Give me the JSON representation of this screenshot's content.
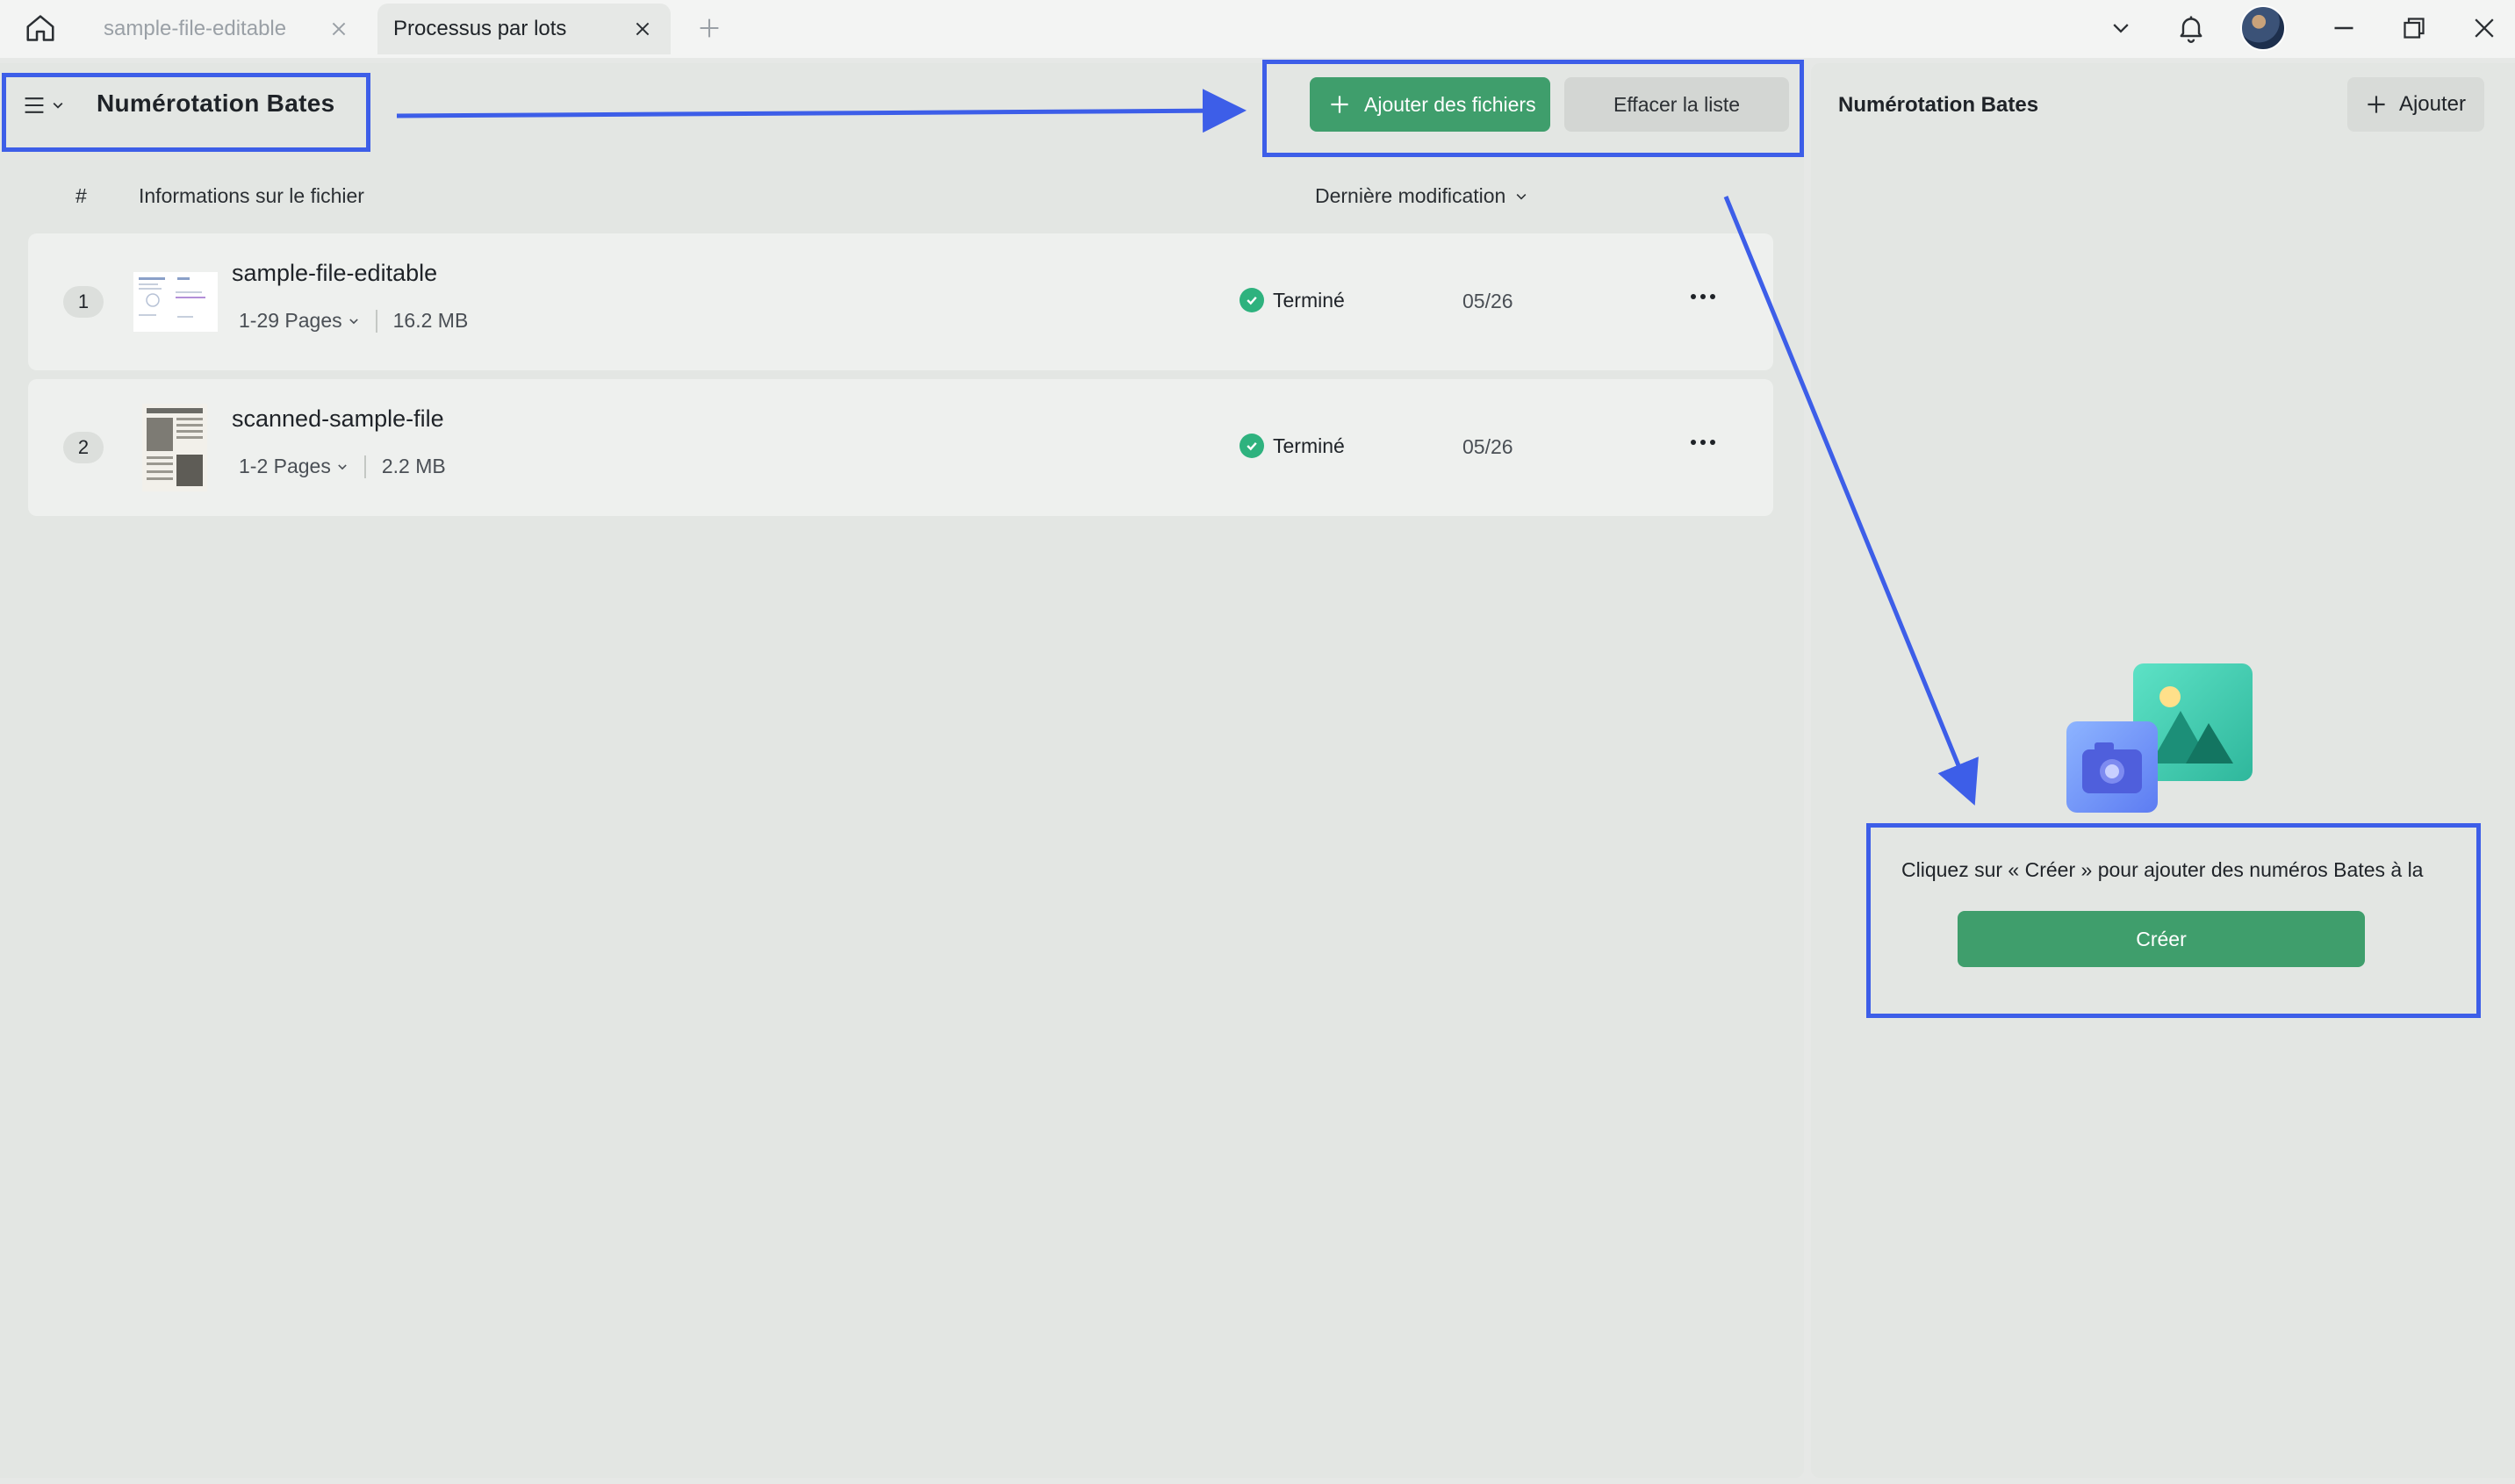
{
  "tabs": [
    {
      "label": "sample-file-editable",
      "active": false
    },
    {
      "label": "Processus par lots",
      "active": true
    }
  ],
  "header": {
    "title": "Numérotation Bates",
    "add_files_label": "Ajouter des fichiers",
    "clear_list_label": "Effacer la liste"
  },
  "columns": {
    "index": "#",
    "info": "Informations sur le fichier",
    "date": "Dernière modification"
  },
  "files": [
    {
      "index": "1",
      "name": "sample-file-editable",
      "pages": "1-29 Pages",
      "size": "16.2 MB",
      "status": "Terminé",
      "date": "05/26"
    },
    {
      "index": "2",
      "name": "scanned-sample-file",
      "pages": "1-2 Pages",
      "size": "2.2 MB",
      "status": "Terminé",
      "date": "05/26"
    }
  ],
  "side_panel": {
    "title": "Numérotation Bates",
    "add_label": "Ajouter",
    "empty_message": "Cliquez sur « Créer » pour ajouter des numéros Bates à la",
    "create_label": "Créer"
  },
  "colors": {
    "accent_green": "#3f9e6c",
    "status_green": "#2eb27e",
    "annotation_blue": "#3d5ee8"
  },
  "icons": [
    "home-icon",
    "close-icon",
    "plus-icon",
    "chevron-down-icon",
    "bell-icon",
    "minimize-icon",
    "restore-icon",
    "hamburger-icon",
    "check-icon",
    "more-icon",
    "camera-icon",
    "image-icon"
  ]
}
